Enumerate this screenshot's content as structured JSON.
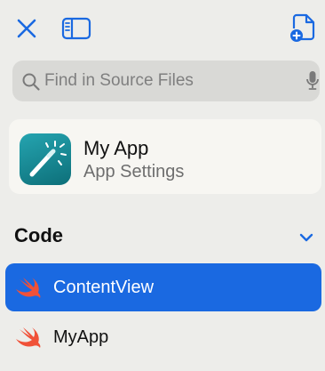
{
  "colors": {
    "accent": "#1a69e1",
    "swift_orange": "#f05138",
    "background": "#ededea",
    "search_background": "#d9d9d6",
    "card_background": "#f7f6f2"
  },
  "toolbar": {
    "close_icon": "close-icon",
    "sidebar_icon": "sidebar-toggle-icon",
    "new_file_icon": "new-file-icon"
  },
  "search": {
    "placeholder": "Find in Source Files",
    "value": "",
    "icon": "magnifier-icon",
    "mic_icon": "microphone-icon"
  },
  "project": {
    "name": "My App",
    "subtitle": "App Settings",
    "icon": "app-wand-icon"
  },
  "files_section": {
    "title": "Code",
    "chevron_icon": "chevron-down-icon",
    "items": [
      {
        "label": "ContentView",
        "icon": "swift-icon",
        "selected": true
      },
      {
        "label": "MyApp",
        "icon": "swift-icon",
        "selected": false
      }
    ]
  }
}
